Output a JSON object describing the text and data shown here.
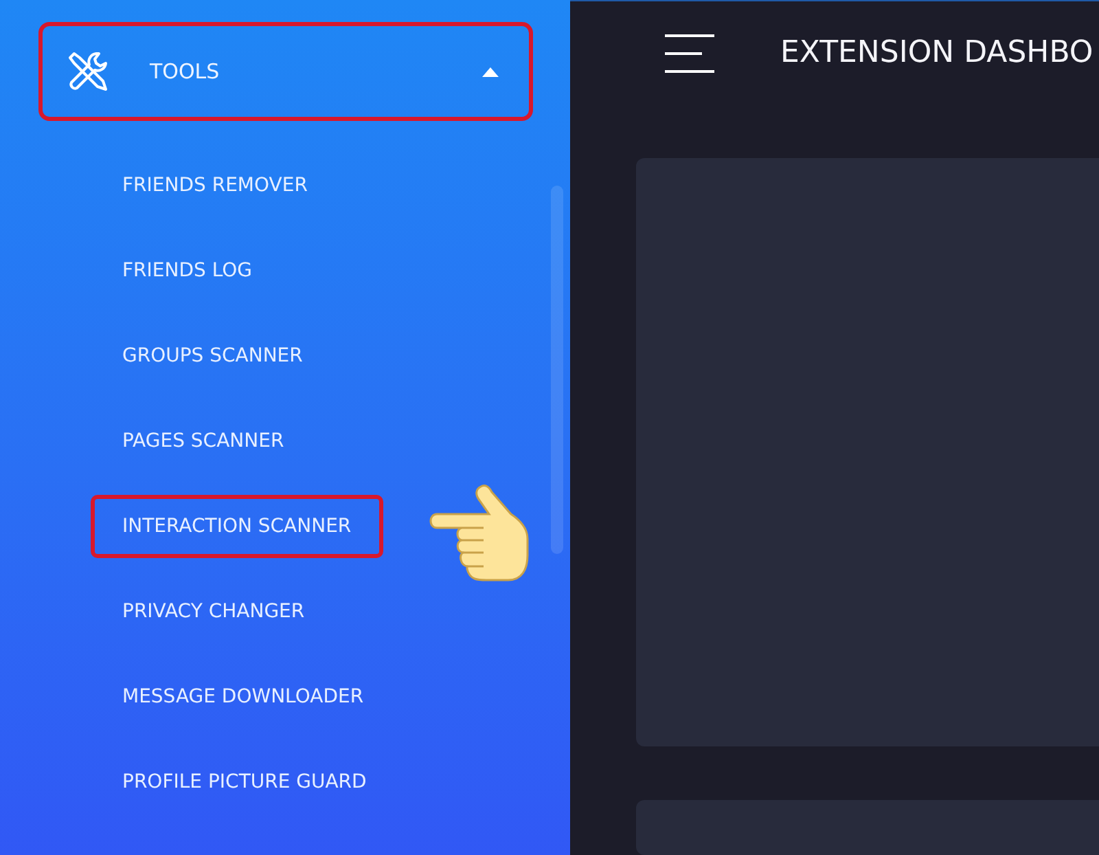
{
  "sidebar": {
    "section": {
      "label": "TOOLS",
      "expanded": true,
      "highlighted": true
    },
    "items": [
      {
        "label": "FRIENDS REMOVER",
        "highlighted": false
      },
      {
        "label": "FRIENDS LOG",
        "highlighted": false
      },
      {
        "label": "GROUPS SCANNER",
        "highlighted": false
      },
      {
        "label": "PAGES SCANNER",
        "highlighted": false
      },
      {
        "label": "INTERACTION SCANNER",
        "highlighted": true
      },
      {
        "label": "PRIVACY CHANGER",
        "highlighted": false
      },
      {
        "label": "MESSAGE DOWNLOADER",
        "highlighted": false
      },
      {
        "label": "PROFILE PICTURE GUARD",
        "highlighted": false
      }
    ]
  },
  "header": {
    "title": "EXTENSION DASHBO"
  }
}
